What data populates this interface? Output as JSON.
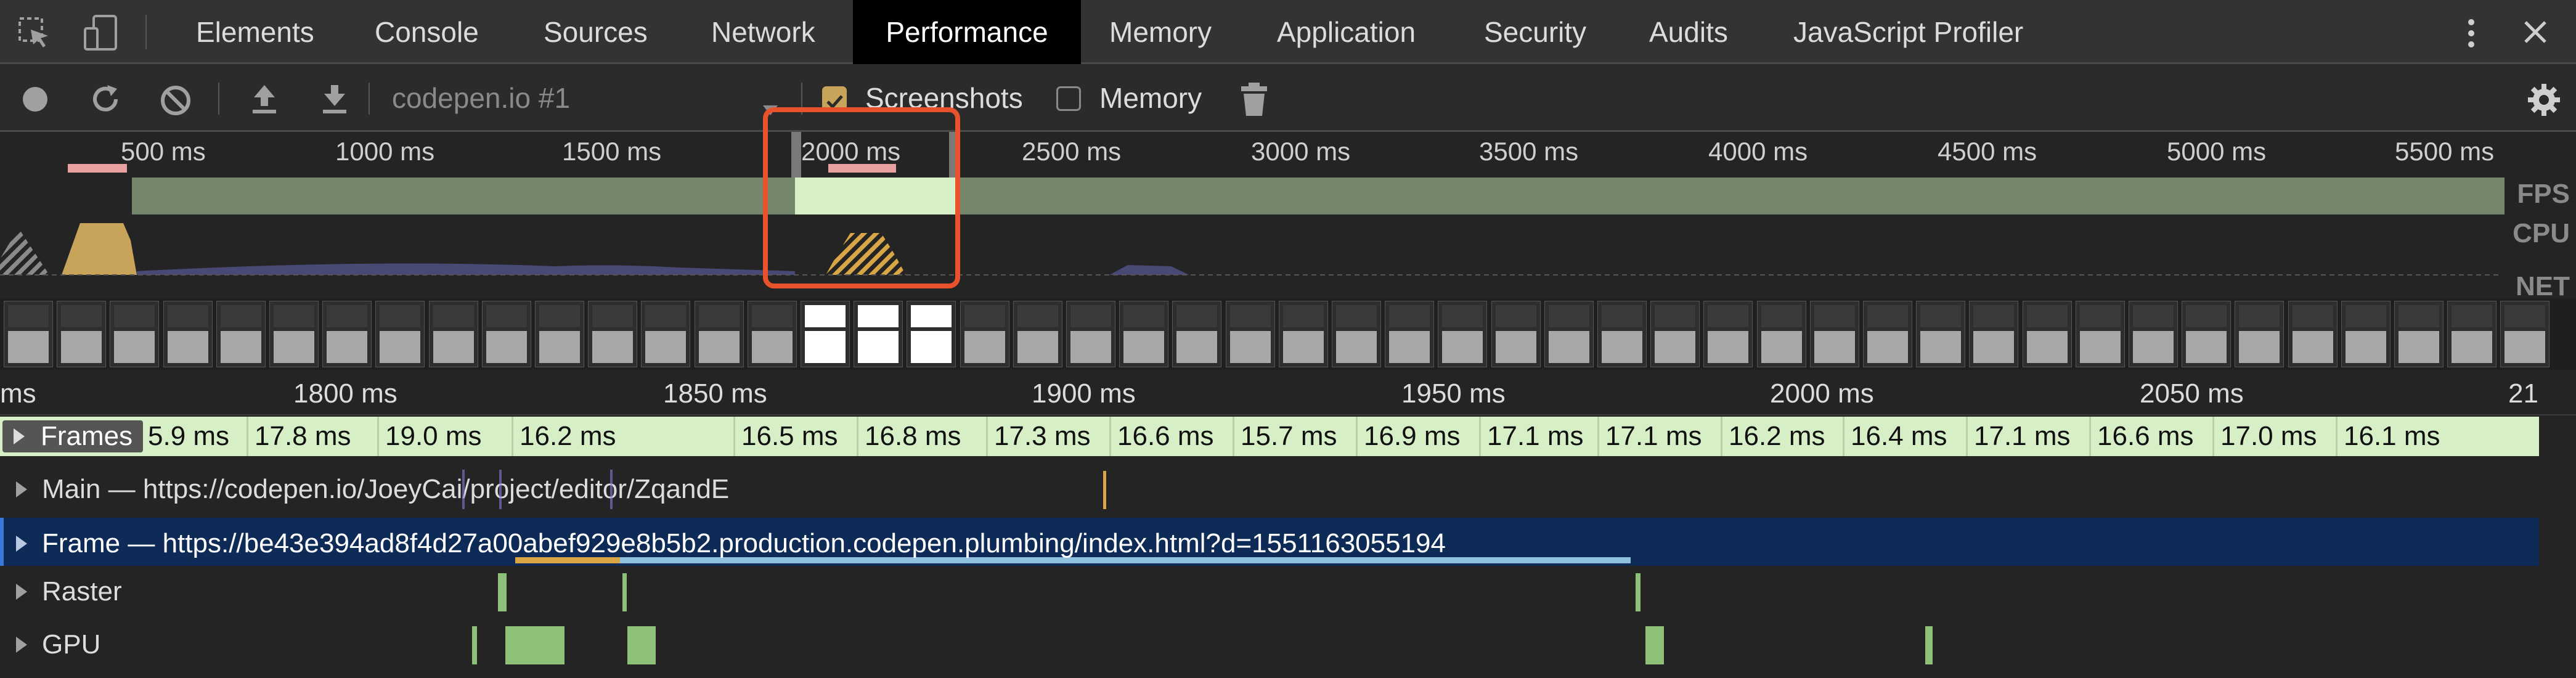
{
  "tabs": [
    {
      "label": "Elements",
      "active": false
    },
    {
      "label": "Console",
      "active": false
    },
    {
      "label": "Sources",
      "active": false
    },
    {
      "label": "Network",
      "active": false
    },
    {
      "label": "Performance",
      "active": true
    },
    {
      "label": "Memory",
      "active": false
    },
    {
      "label": "Application",
      "active": false
    },
    {
      "label": "Security",
      "active": false
    },
    {
      "label": "Audits",
      "active": false
    },
    {
      "label": "JavaScript Profiler",
      "active": false
    }
  ],
  "toolbar": {
    "profile_select": "codepen.io #1",
    "screenshots_label": "Screenshots",
    "screenshots_checked": true,
    "memory_label": "Memory",
    "memory_checked": false
  },
  "overview": {
    "ruler": [
      "500 ms",
      "1000 ms",
      "1500 ms",
      "2000 ms",
      "2500 ms",
      "3000 ms",
      "3500 ms",
      "4000 ms",
      "4500 ms",
      "5000 ms",
      "5500 ms"
    ],
    "lanes": [
      "FPS",
      "CPU",
      "NET"
    ]
  },
  "timeline": {
    "ruler": [
      "ms",
      "1800 ms",
      "1850 ms",
      "1900 ms",
      "1950 ms",
      "2000 ms",
      "2050 ms",
      "21"
    ]
  },
  "frames": {
    "label": "Frames",
    "durations": [
      "5.9 ms",
      "17.8 ms",
      "19.0 ms",
      "16.2 ms",
      "16.5 ms",
      "16.8 ms",
      "17.3 ms",
      "16.6 ms",
      "15.7 ms",
      "16.9 ms",
      "17.1 ms",
      "17.1 ms",
      "16.2 ms",
      "16.4 ms",
      "17.1 ms",
      "16.6 ms",
      "17.0 ms",
      "16.1 ms"
    ]
  },
  "tracks": {
    "main": "Main — https://codepen.io/JoeyCai/project/editor/ZqandE",
    "frame": "Frame — https://be43e394ad8f4d27a00abef929e8b5b2.production.codepen.plumbing/index.html?d=1551163055194",
    "raster": "Raster",
    "gpu": "GPU"
  },
  "colors": {
    "active_tab_bg": "#000000",
    "highlight_box": "#e8532e",
    "fps_green": "#cfe8c0",
    "cpu_scripting": "#c8a35a",
    "selected_track": "#0d2b56"
  }
}
